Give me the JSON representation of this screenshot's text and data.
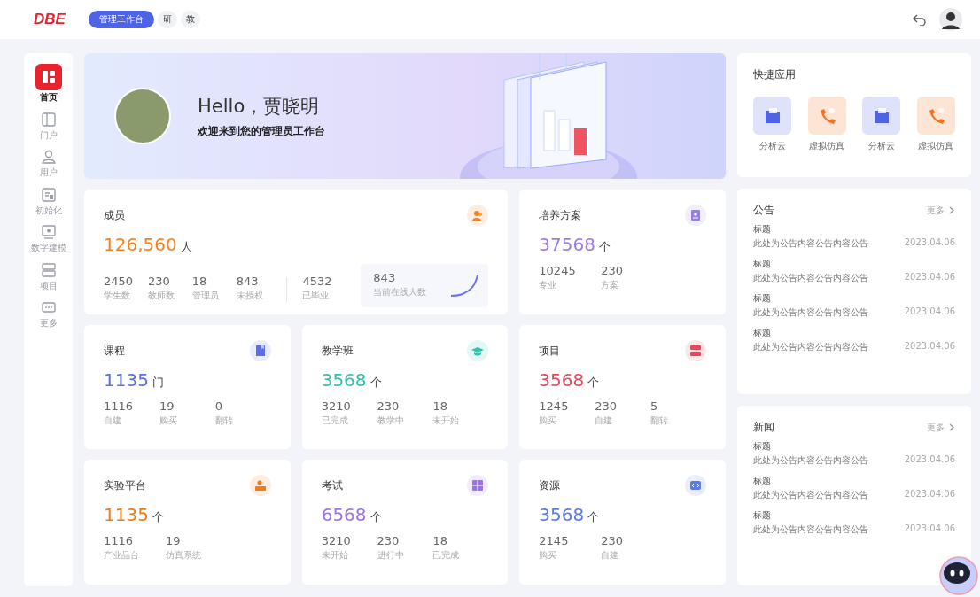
{
  "top_bar": {
    "logo": "DBE",
    "tabs": [
      {
        "label": "管理工作台",
        "selected": true
      },
      {
        "label": "研",
        "selected": false
      },
      {
        "label": "教",
        "selected": false
      }
    ]
  },
  "sidebar": {
    "items": [
      {
        "label": "首页",
        "selected": true
      },
      {
        "label": "门户",
        "selected": false
      },
      {
        "label": "用户",
        "selected": false
      },
      {
        "label": "初始化",
        "selected": false
      },
      {
        "label": "数字建模",
        "selected": false
      },
      {
        "label": "项目",
        "selected": false
      },
      {
        "label": "更多",
        "selected": false
      }
    ]
  },
  "banner": {
    "greeting": "Hello，贾晓明",
    "subtitle": "欢迎来到您的管理员工作台"
  },
  "cards": [
    {
      "kind": "members",
      "title": "成员",
      "value": "126,560",
      "unit": "人",
      "color": "#f5821f",
      "stats": [
        {
          "value": "2450",
          "label": "学生数"
        },
        {
          "value": "230",
          "label": "教师数"
        },
        {
          "value": "18",
          "label": "管理员"
        },
        {
          "value": "843",
          "label": "未授权"
        }
      ],
      "extra_stats": [
        {
          "value": "4532",
          "label": "已毕业"
        }
      ],
      "online": {
        "value": "843",
        "label": "当前在线人数"
      }
    },
    {
      "kind": "stat",
      "title": "培养方案",
      "value": "37568",
      "unit": "个",
      "color": "#9a7ce6",
      "stats": [
        {
          "value": "10245",
          "label": "专业"
        },
        {
          "value": "230",
          "label": "方案"
        }
      ]
    },
    {
      "kind": "stat",
      "title": "课程",
      "value": "1135",
      "unit": "门",
      "color": "#5b6ee8",
      "stats": [
        {
          "value": "1116",
          "label": "自建"
        },
        {
          "value": "19",
          "label": "购买"
        },
        {
          "value": "0",
          "label": "翻转"
        }
      ]
    },
    {
      "kind": "stat",
      "title": "教学班",
      "value": "3568",
      "unit": "个",
      "color": "#2ec2ae",
      "stats": [
        {
          "value": "3210",
          "label": "已完成"
        },
        {
          "value": "230",
          "label": "教学中"
        },
        {
          "value": "18",
          "label": "未开始"
        }
      ]
    },
    {
      "kind": "stat",
      "title": "项目",
      "value": "3568",
      "unit": "个",
      "color": "#e8495a",
      "stats": [
        {
          "value": "1245",
          "label": "购买"
        },
        {
          "value": "230",
          "label": "自建"
        },
        {
          "value": "5",
          "label": "翻转"
        }
      ]
    },
    {
      "kind": "stat",
      "title": "实验平台",
      "value": "1135",
      "unit": "个",
      "color": "#f07b1a",
      "stats": [
        {
          "value": "1116",
          "label": "产业品台"
        },
        {
          "value": "19",
          "label": "仿真系统"
        }
      ]
    },
    {
      "kind": "stat",
      "title": "考试",
      "value": "6568",
      "unit": "个",
      "color": "#9b72e8",
      "stats": [
        {
          "value": "3210",
          "label": "未开始"
        },
        {
          "value": "230",
          "label": "进行中"
        },
        {
          "value": "18",
          "label": "已完成"
        }
      ]
    },
    {
      "kind": "stat",
      "title": "资源",
      "value": "3568",
      "unit": "个",
      "color": "#5b7be8",
      "stats": [
        {
          "value": "2145",
          "label": "购买"
        },
        {
          "value": "230",
          "label": "自建"
        }
      ]
    }
  ],
  "quick_apps": {
    "title": "快捷应用",
    "items": [
      {
        "label": "分析云",
        "color": "#4f63e6"
      },
      {
        "label": "虚拟仿真",
        "color": "#f5731f"
      },
      {
        "label": "分析云",
        "color": "#4f63e6"
      },
      {
        "label": "虚拟仿真",
        "color": "#f5731f"
      }
    ]
  },
  "notices": {
    "title": "公告",
    "more": "更多",
    "items": [
      {
        "title": "标题",
        "body": "此处为公告内容公告内容公告",
        "date": "2023.04.06"
      },
      {
        "title": "标题",
        "body": "此处为公告内容公告内容公告",
        "date": "2023.04.06"
      },
      {
        "title": "标题",
        "body": "此处为公告内容公告内容公告",
        "date": "2023.04.06"
      },
      {
        "title": "标题",
        "body": "此处为公告内容公告内容公告",
        "date": "2023.04.06"
      }
    ]
  },
  "news": {
    "title": "新闻",
    "more": "更多",
    "items": [
      {
        "title": "标题",
        "body": "此处为公告内容公告内容公告",
        "date": "2023.04.06"
      },
      {
        "title": "标题",
        "body": "此处为公告内容公告内容公告",
        "date": "2023.04.06"
      },
      {
        "title": "标题",
        "body": "此处为公告内容公告内容公告",
        "date": "2023.04.06"
      }
    ]
  }
}
